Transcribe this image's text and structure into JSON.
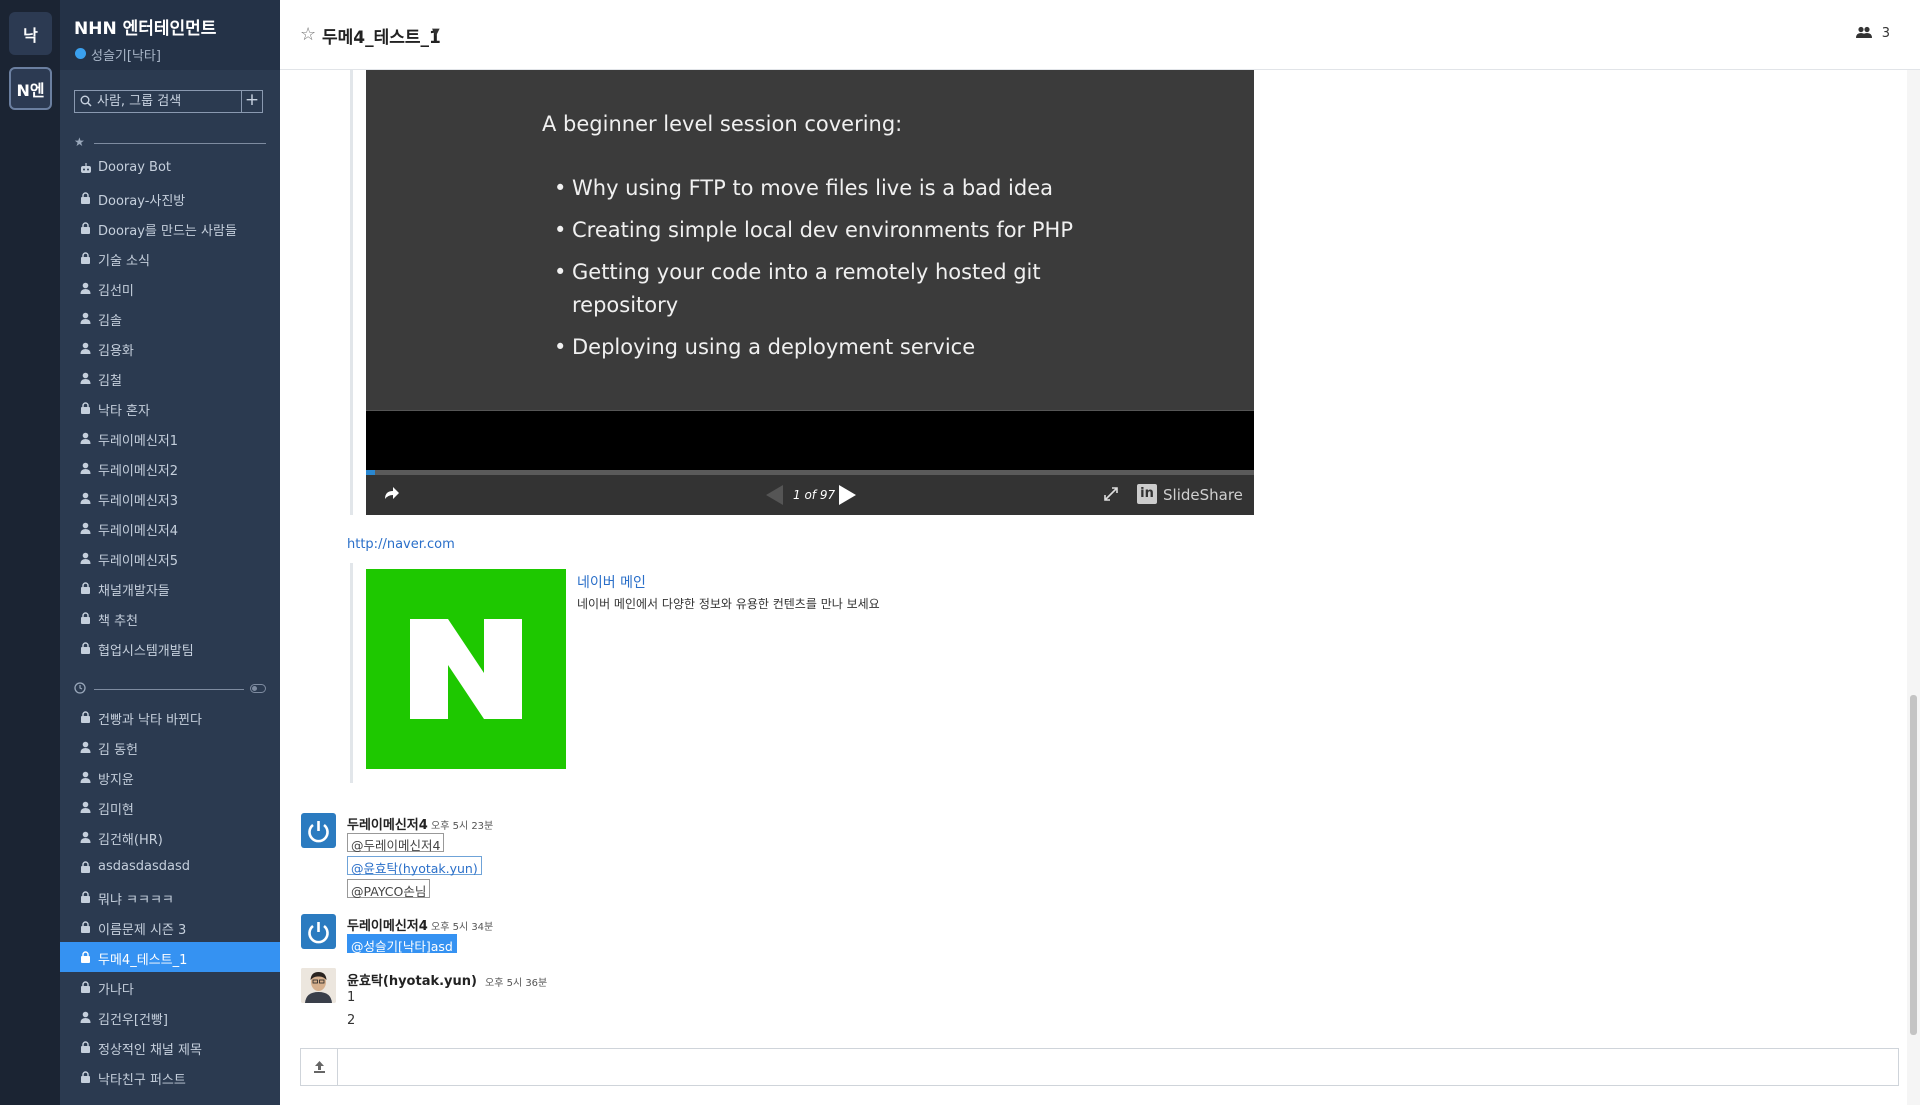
{
  "tenants": [
    {
      "label": "낙"
    },
    {
      "label": "N엔"
    }
  ],
  "org": {
    "name": "NHN 엔터테인먼트",
    "me": "성슬기[낙타]"
  },
  "search": {
    "placeholder": "사람, 그룹 검색",
    "add_label": "+"
  },
  "favorites": [
    {
      "label": "Dooray Bot",
      "icon": "bot-icon"
    },
    {
      "label": "Dooray-사진방",
      "icon": "lock-icon"
    },
    {
      "label": "Dooray를 만드는 사람들",
      "icon": "lock-icon"
    },
    {
      "label": "기술 소식",
      "icon": "lock-icon"
    },
    {
      "label": "김선미",
      "icon": "user-icon"
    },
    {
      "label": "김솔",
      "icon": "user-icon"
    },
    {
      "label": "김용화",
      "icon": "user-icon"
    },
    {
      "label": "김철",
      "icon": "user-icon"
    },
    {
      "label": "낙타 혼자",
      "icon": "lock-icon"
    },
    {
      "label": "두레이메신저1",
      "icon": "user-icon"
    },
    {
      "label": "두레이메신저2",
      "icon": "user-icon"
    },
    {
      "label": "두레이메신저3",
      "icon": "user-icon"
    },
    {
      "label": "두레이메신저4",
      "icon": "user-icon"
    },
    {
      "label": "두레이메신저5",
      "icon": "user-icon"
    },
    {
      "label": "채널개발자들",
      "icon": "lock-icon"
    },
    {
      "label": "책 추천",
      "icon": "lock-icon"
    },
    {
      "label": "협업시스템개발팀",
      "icon": "lock-icon"
    }
  ],
  "recent": [
    {
      "label": "건빵과 낙타 바뀐다",
      "icon": "lock-icon"
    },
    {
      "label": "김 동헌",
      "icon": "user-icon"
    },
    {
      "label": "방지윤",
      "icon": "user-icon"
    },
    {
      "label": "김미현",
      "icon": "user-icon"
    },
    {
      "label": "김건해(HR)",
      "icon": "user-icon"
    },
    {
      "label": "asdasdasdasd",
      "icon": "lock-icon"
    },
    {
      "label": "뭐냐 ㅋㅋㅋㅋ",
      "icon": "lock-icon"
    },
    {
      "label": "이름문제 시즌 3",
      "icon": "lock-icon"
    },
    {
      "label": "두메4_테스트_1",
      "icon": "lock-icon",
      "active": true
    },
    {
      "label": "가나다",
      "icon": "lock-icon"
    },
    {
      "label": "김건우[건빵]",
      "icon": "user-icon"
    },
    {
      "label": "정상적인 채널 제목",
      "icon": "lock-icon"
    },
    {
      "label": "낙타친구 퍼스트",
      "icon": "lock-icon"
    }
  ],
  "header": {
    "title": "두메4_테스트_1",
    "member_count": "3"
  },
  "slideshare": {
    "heading": "A beginner level session covering:",
    "bullets": [
      "Why using FTP to move files live is a bad idea",
      "Creating simple local dev environments for PHP",
      "Getting your code into a remotely hosted git repository",
      "Deploying using a deployment service"
    ],
    "page_indicator": "1 of 97",
    "progress": 0.01,
    "brand": "SlideShare",
    "brand_badge": "in"
  },
  "link_preview": {
    "url": "http://naver.com",
    "title": "네이버 메인",
    "description": "네이버 메인에서 다양한 정보와 유용한 컨텐츠를 만나 보세요",
    "image_color": "#1ec800"
  },
  "messages": [
    {
      "sender": "두레이메신저4",
      "time": "오후 5시 23분",
      "mentions": [
        "@두레이메신저4",
        "@윤효탁(hyotak.yun)",
        "@PAYCO손님"
      ]
    },
    {
      "sender": "두레이메신저4",
      "time": "오후 5시 34분",
      "mentions": [
        "@성슬기[낙타]asd"
      ]
    },
    {
      "sender": "윤효탁(hyotak.yun)",
      "time": "오후 5시 36분",
      "lines": [
        "1",
        "2"
      ]
    }
  ],
  "colors": {
    "accent": "#3592f2",
    "sidebar": "#2b3a50",
    "rail": "#1b2433",
    "link": "#2a6fc9"
  }
}
